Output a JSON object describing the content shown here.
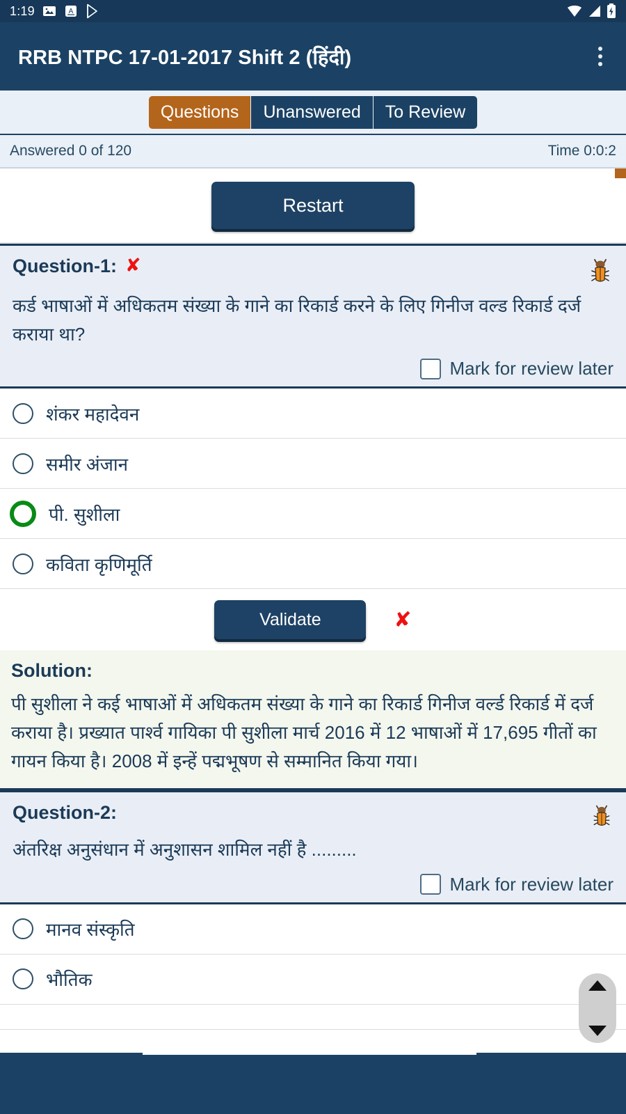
{
  "status_bar": {
    "time": "1:19",
    "left_icons": [
      "image-icon",
      "screenshot-a-icon",
      "play-store-icon"
    ],
    "right_icons": [
      "wifi-icon",
      "cellular-signal-icon",
      "battery-charging-icon"
    ]
  },
  "app_bar": {
    "title": "RRB NTPC 17-01-2017 Shift 2 (हिंदी)",
    "overflow_label": "more-options"
  },
  "tabs": [
    {
      "label": "Questions",
      "active": true
    },
    {
      "label": "Unanswered",
      "active": false
    },
    {
      "label": "To Review",
      "active": false
    }
  ],
  "progress": {
    "answered_text": "Answered 0 of 120",
    "time_text": "Time 0:0:2"
  },
  "toolbar": {
    "restart_label": "Restart"
  },
  "questions": [
    {
      "label": "Question-1:",
      "result_mark": "✘",
      "text": "कर्ड भाषाओं में अधिकतम संख्या के गाने का रिकार्ड करने के लिए गिनीज वल्ड रिकार्ड दर्ज कराया था?",
      "mark_review_label": "Mark for review later",
      "options": [
        {
          "text": "शंकर महादेवन",
          "state": "normal"
        },
        {
          "text": "समीर अंजान",
          "state": "normal"
        },
        {
          "text": "पी. सुशीला",
          "state": "correct"
        },
        {
          "text": "कविता कृणिमूर्ति",
          "state": "normal"
        }
      ],
      "validate_label": "Validate",
      "validate_mark": "✘",
      "solution_title": "Solution:",
      "solution_text": "पी सुशीला ने कई भाषाओं में अधिकतम संख्या के गाने का रिकार्ड गिनीज वर्ल्ड रिकार्ड में दर्ज कराया है। प्रख्यात पार्श्व गायिका पी सुशीला मार्च 2016 में 12 भाषाओं में 17,695 गीतों का गायन किया है। 2008 में इन्हें पद्मभूषण से सम्मानित किया गया।"
    },
    {
      "label": "Question-2:",
      "result_mark": "",
      "text": "अंतरिक्ष अनुसंधान में अनुशासन शामिल नहीं है .........",
      "mark_review_label": "Mark for review later",
      "options": [
        {
          "text": "मानव संस्कृति",
          "state": "normal"
        },
        {
          "text": "भौतिक",
          "state": "normal"
        }
      ]
    }
  ],
  "scroller": {
    "up_icon": "triangle-up-icon",
    "down_icon": "triangle-down-icon"
  },
  "colors": {
    "app_bar": "#1b4264",
    "status_bar": "#173858",
    "tab_active": "#b4651c",
    "tab_inactive": "#1b4264",
    "panel": "#e9eef6",
    "solution_bg": "#f4f7ee",
    "correct": "#0a8a17",
    "wrong": "#ee1111"
  }
}
